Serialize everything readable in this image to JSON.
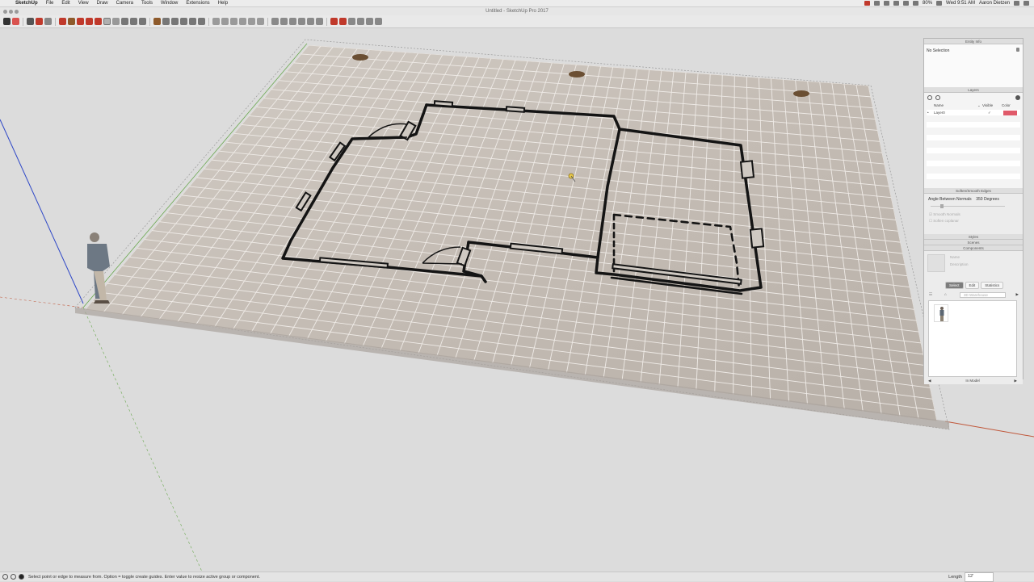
{
  "menubar": {
    "app_name": "SketchUp",
    "items": [
      "File",
      "Edit",
      "View",
      "Draw",
      "Camera",
      "Tools",
      "Window",
      "Extensions",
      "Help"
    ],
    "battery": "80%",
    "clock": "Wed 9:51 AM",
    "user": "Aaron Dietzen"
  },
  "window": {
    "title": "Untitled - SketchUp Pro 2017"
  },
  "statusbar": {
    "hint": "Select point or edge to measure from.  Option = toggle create guides.  Enter value to resize active group or component.",
    "measure_label": "Length",
    "measure_value": "12'"
  },
  "tray": {
    "entity_info": {
      "title": "Entity Info",
      "selection": "No Selection"
    },
    "layers": {
      "title": "Layers",
      "col_name": "Name",
      "col_visible": "Visible",
      "col_color": "Color",
      "row_name": "Layer0",
      "layer_color": "#e05a6a"
    },
    "soften": {
      "title": "Soften/Smooth Edges",
      "angle_label": "Angle Between Normals",
      "angle_value": "350",
      "angle_unit": "Degrees",
      "smooth_normals": "Smooth Normals",
      "soften_coplanar": "Soften coplanar"
    },
    "styles": {
      "title": "Styles"
    },
    "scenes": {
      "title": "Scenes"
    },
    "components": {
      "title": "Components",
      "name_placeholder": "Name",
      "description_placeholder": "Description",
      "tab_select": "Select",
      "tab_edit": "Edit",
      "tab_statistics": "Statistics",
      "search_placeholder": "3D Warehouse",
      "footer": "In Model"
    }
  },
  "colors": {
    "sheet": "#c6bfb7",
    "grid": "#eeeae6",
    "ink": "#141414",
    "axis_red": "#c0573a",
    "axis_green": "#6aa84f",
    "axis_blue": "#2f48c7"
  }
}
